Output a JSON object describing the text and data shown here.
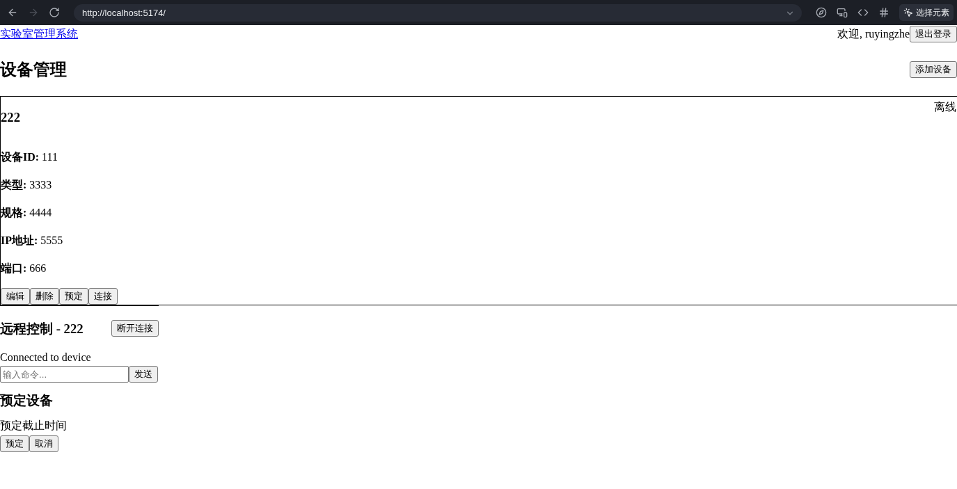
{
  "browser": {
    "nav": [
      {
        "kind": "back",
        "disabled": false
      },
      {
        "kind": "forward",
        "disabled": true
      },
      {
        "kind": "reload",
        "disabled": false
      }
    ],
    "url": "http://localhost:5174/",
    "select_element_button": "选择元素"
  },
  "header": {
    "brand_link": "实验室管理系统",
    "welcome": "欢迎, ruyingzhe",
    "logout_button": "退出登录"
  },
  "page": {
    "title": "设备管理",
    "add_button": "添加设备"
  },
  "devices": [
    {
      "name": "222",
      "status": "离线",
      "fields": [
        "**设备ID:** 111",
        "**类型:** 3333",
        "**规格:** 4444",
        "**IP地址:** 5555",
        "**端口:** 666"
      ],
      "actions": [
        "编辑",
        "删除",
        "预定",
        "连接"
      ]
    }
  ],
  "remote_control": {
    "title": "远程控制 - 222",
    "disconnect_button": "断开连接",
    "status": "Connected to device",
    "command_input": {
      "placeholder": "输入命令..."
    },
    "send_button": "发送"
  },
  "booking_dialog": {
    "title": "预定设备",
    "deadline_label": "预定截止时间",
    "buttons": [
      "预定",
      "取消"
    ]
  }
}
